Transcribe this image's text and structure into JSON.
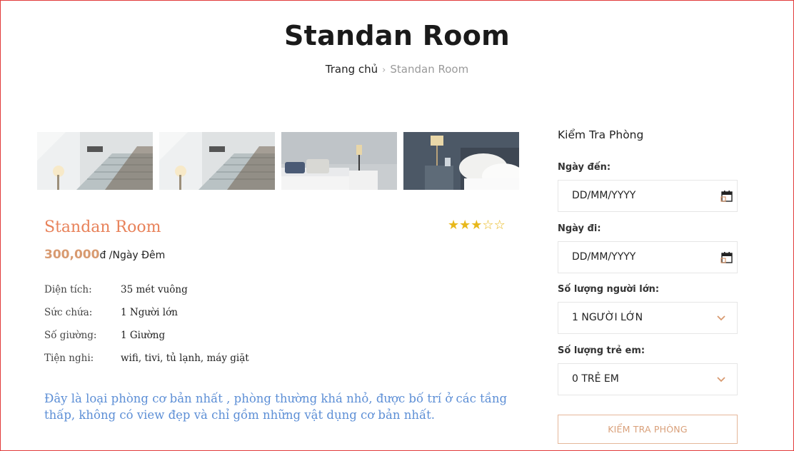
{
  "header": {
    "title": "Standan Room",
    "breadcrumb": {
      "home": "Trang chủ",
      "separator": "›",
      "current": "Standan Room"
    }
  },
  "gallery": {
    "images": [
      {
        "name": "staircase-photo-1"
      },
      {
        "name": "staircase-photo-2"
      },
      {
        "name": "bedroom-lamp-photo"
      },
      {
        "name": "bedroom-pillows-photo"
      }
    ]
  },
  "room": {
    "name": "Standan Room",
    "rating": 3,
    "rating_max": 5,
    "star_filled": "★",
    "star_empty": "☆",
    "price": "300,000",
    "price_unit": "đ /Ngày Đêm",
    "specs": [
      {
        "label": "Diện tích:",
        "value": "35 mét vuông"
      },
      {
        "label": "Sức chứa:",
        "value": "1 Người lớn"
      },
      {
        "label": "Số giường:",
        "value": "1 Giường"
      },
      {
        "label": "Tiện nghi:",
        "value": "wifi, tivi, tủ lạnh, máy giặt"
      }
    ],
    "description": "Đây là loại phòng cơ bản nhất , phòng thường khá nhỏ, được bố trí ở các tầng thấp, không có view đẹp và chỉ gồm những vật dụng cơ bản nhất."
  },
  "booking": {
    "title": "Kiểm Tra Phòng",
    "arrival_label": "Ngày đến:",
    "arrival_value": "DD/MM/YYYY",
    "departure_label": "Ngày đi:",
    "departure_value": "DD/MM/YYYY",
    "adults_label": "Số lượng người lớn:",
    "adults_value": "1 NGƯỜI LỚN",
    "children_label": "Số lượng trẻ em:",
    "children_value": "0 TRẺ EM",
    "submit_label": "KIỂM TRA PHÒNG"
  },
  "colors": {
    "accent": "#e8825a",
    "price": "#d89a70",
    "description": "#5d8fd6",
    "star": "#e8b81c",
    "frame": "#e23b3b"
  }
}
